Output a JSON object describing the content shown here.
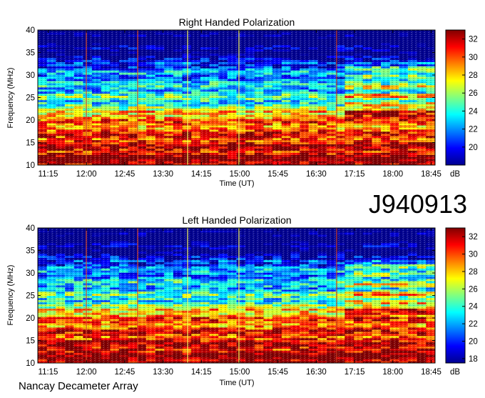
{
  "observation_id": "J940913",
  "footer": "Nancay Decameter Array",
  "chart_data": [
    {
      "type": "heatmap",
      "title": "Right Handed Polarization",
      "xlabel": "Time (UT)",
      "ylabel": "Frequency (MHz)",
      "x_ticks": [
        "11:15",
        "12:00",
        "12:45",
        "13:30",
        "14:15",
        "15:00",
        "15:45",
        "16:30",
        "17:15",
        "18:00",
        "18:45"
      ],
      "y_ticks": [
        10,
        15,
        20,
        25,
        30,
        35,
        40
      ],
      "ylim": [
        10,
        40
      ],
      "colorbar": {
        "label": "dB",
        "ticks": [
          20,
          22,
          24,
          26,
          28,
          30,
          32
        ],
        "range": [
          18,
          33
        ],
        "colors": [
          "#00008f",
          "#0000ff",
          "#0080ff",
          "#00ffff",
          "#80ff80",
          "#ffff00",
          "#ff8000",
          "#ff0000",
          "#800000"
        ]
      }
    },
    {
      "type": "heatmap",
      "title": "Left Handed Polarization",
      "xlabel": "Time (UT)",
      "ylabel": "Frequency (MHz)",
      "x_ticks": [
        "11:15",
        "12:00",
        "12:45",
        "13:30",
        "14:15",
        "15:00",
        "15:45",
        "16:30",
        "17:15",
        "18:00",
        "18:45"
      ],
      "y_ticks": [
        10,
        15,
        20,
        25,
        30,
        35,
        40
      ],
      "ylim": [
        10,
        40
      ],
      "colorbar": {
        "label": "dB",
        "ticks": [
          18,
          20,
          22,
          24,
          26,
          28,
          30,
          32
        ],
        "range": [
          17.5,
          33
        ],
        "colors": [
          "#00008f",
          "#0000ff",
          "#0080ff",
          "#00ffff",
          "#80ff80",
          "#ffff00",
          "#ff8000",
          "#ff0000",
          "#800000"
        ]
      }
    }
  ]
}
